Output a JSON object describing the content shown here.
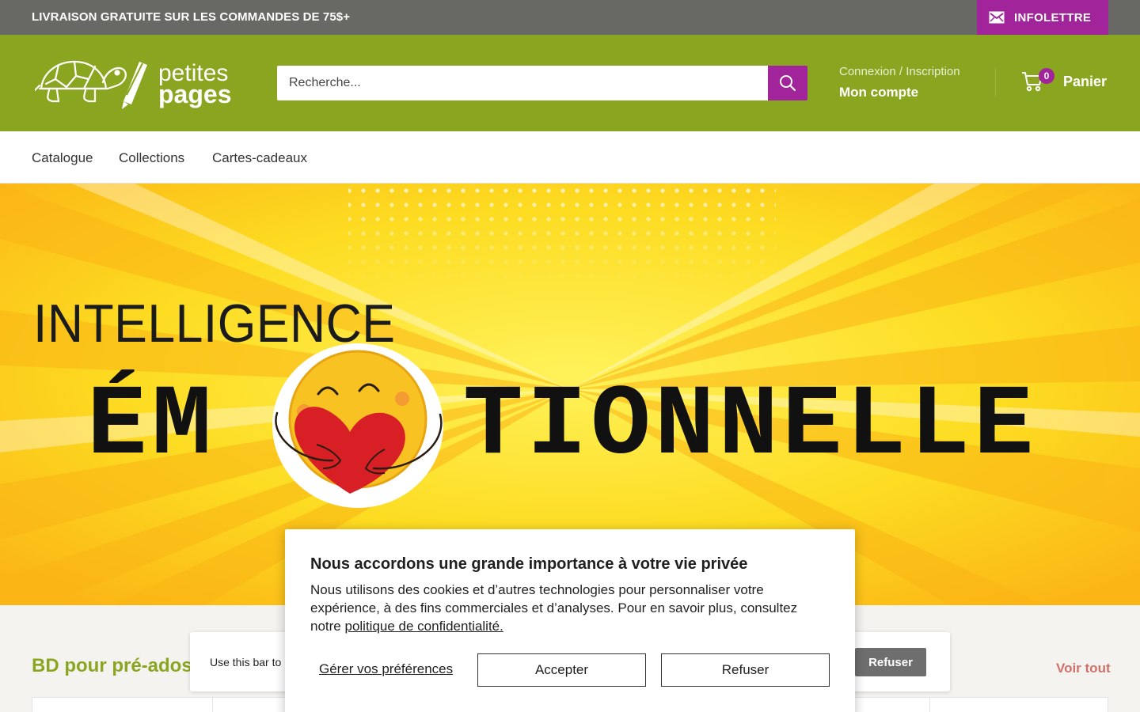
{
  "announcement": {
    "message": "LIVRAISON GRATUITE SUR LES COMMANDES DE 75$+",
    "newsletter_label": "INFOLETTRE",
    "newsletter_icon": "mail-icon"
  },
  "header": {
    "logo_text_top": "petites",
    "logo_text_bottom": "pages",
    "search": {
      "placeholder": "Recherche...",
      "icon": "search-icon"
    },
    "account": {
      "login_label": "Connexion / Inscription",
      "account_label": "Mon compte"
    },
    "cart": {
      "count": "0",
      "label": "Panier",
      "icon": "cart-icon"
    }
  },
  "nav": {
    "items": [
      {
        "label": "Catalogue"
      },
      {
        "label": "Collections"
      },
      {
        "label": "Cartes-cadeaux"
      }
    ]
  },
  "hero": {
    "line1": "INTELLIGENCE",
    "line2_start": "ÉM",
    "line2_end": "TIONNELLE"
  },
  "section": {
    "title": "BD pour pré-ados",
    "view_all": "Voir tout"
  },
  "a11y_bar": {
    "text": "Use this bar to",
    "refuse_label": "Refuser"
  },
  "cookie": {
    "title": "Nous accordons une grande importance à votre vie privée",
    "body": "Nous utilisons des cookies et d’autres technologies pour personnaliser votre expérience, à des fins commerciales et d’analyses. Pour en savoir plus, consultez notre ",
    "policy_link": "politique de confidentialité.",
    "manage_label": "Gérer vos préférences",
    "accept_label": "Accepter",
    "refuse_label": "Refuser"
  },
  "colors": {
    "brand_green": "#8aa620",
    "brand_purple": "#a1249b",
    "announce_gray": "#686864",
    "hero_yellow": "#fcd21c"
  }
}
